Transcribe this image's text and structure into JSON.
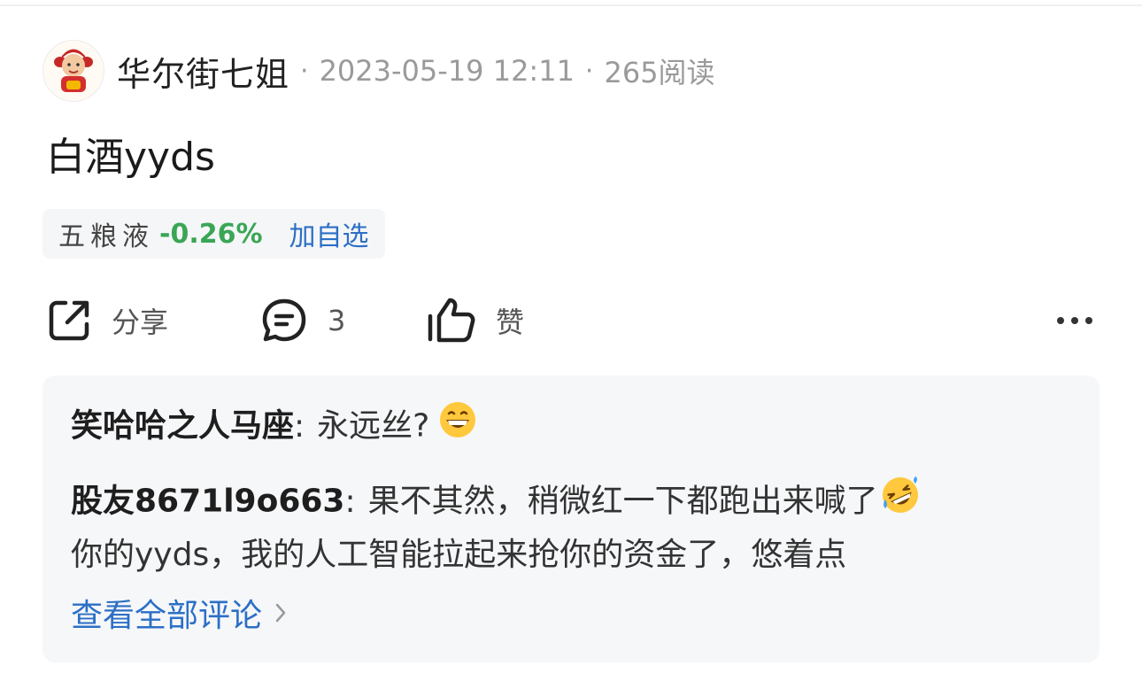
{
  "post": {
    "author": "华尔街七姐",
    "date": "2023-05-19 12:11",
    "reads": "265阅读",
    "content": "白酒yyds"
  },
  "stock": {
    "name": "五粮液",
    "change": "-0.26%",
    "add_label": "加自选"
  },
  "actions": {
    "share_label": "分享",
    "comment_count": "3",
    "like_label": "赞"
  },
  "comments": [
    {
      "user": "笑哈哈之人马座",
      "text": "永远丝?",
      "emoji": "grinning-face"
    },
    {
      "user": "股友8671l9o663",
      "text": "果不其然，稍微红一下都跑出来喊了",
      "emoji": "rolling-laughing-face",
      "text2": "你的yyds，我的人工智能拉起来抢你的资金了，悠着点"
    }
  ],
  "view_all_label": "查看全部评论",
  "colors": {
    "down": "#3aa655",
    "link": "#2c6fc6",
    "muted": "#9a9a9a"
  }
}
